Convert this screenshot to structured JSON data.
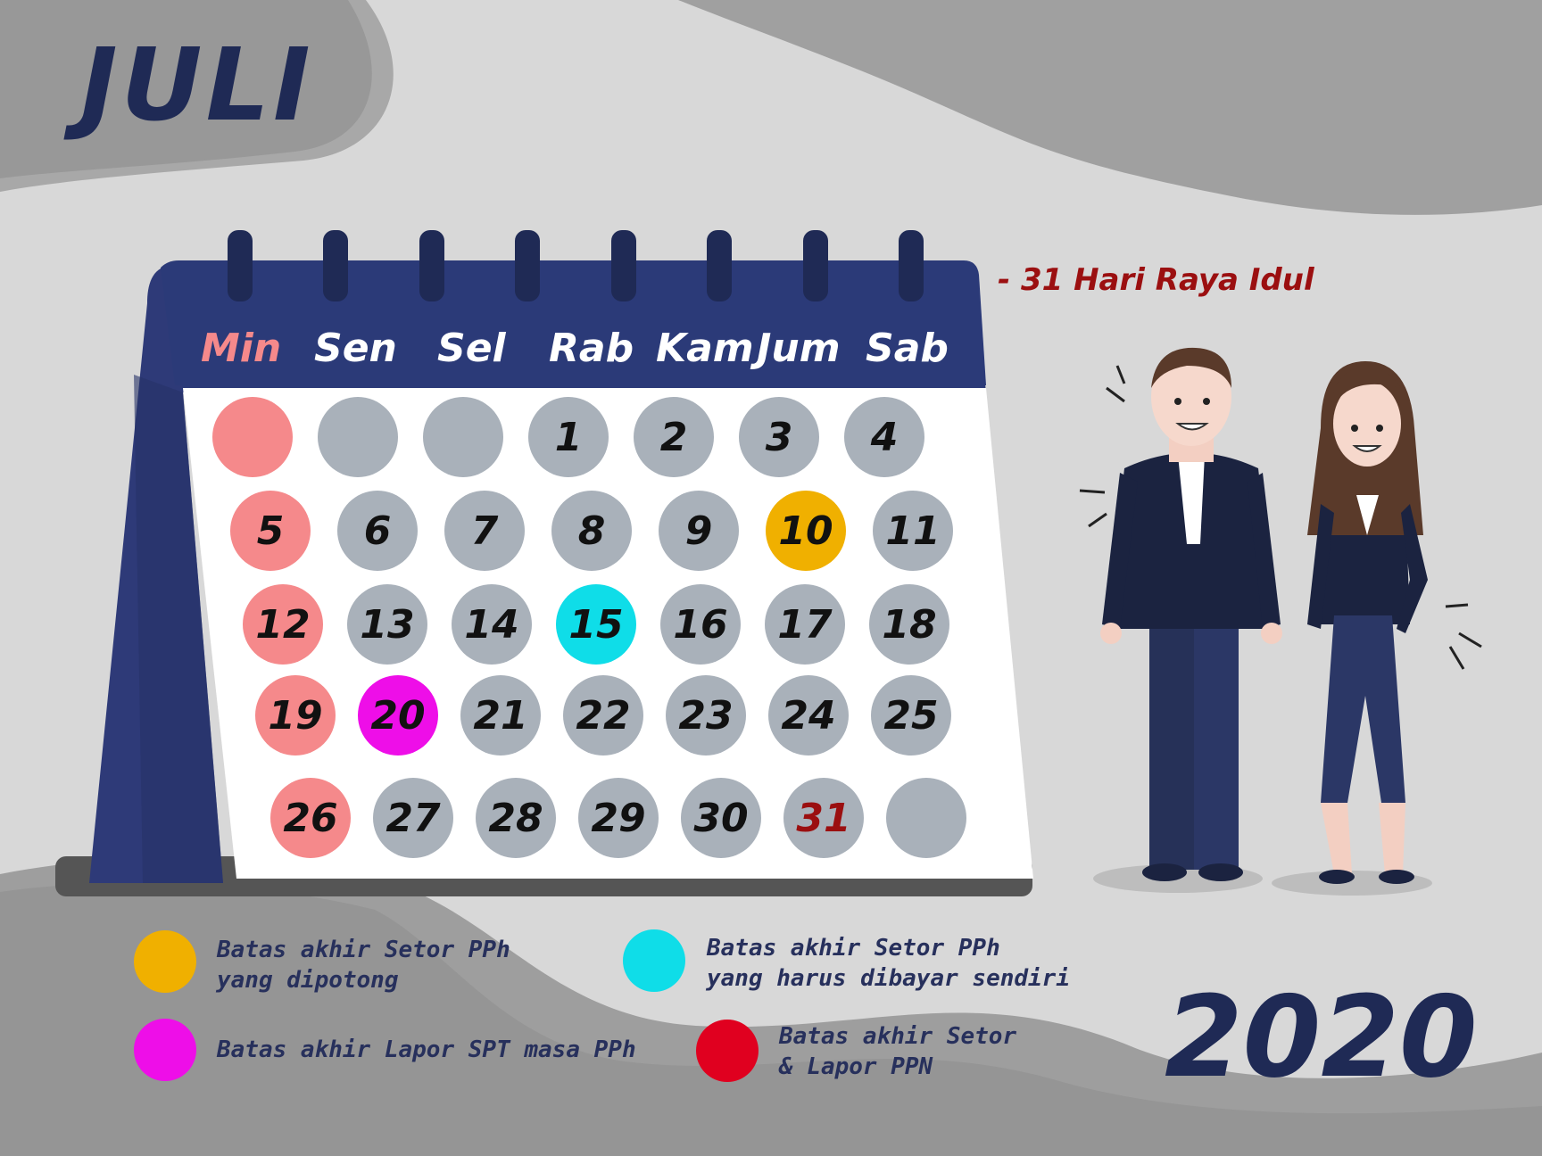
{
  "month": "JULI",
  "year": "2020",
  "holiday_note": "- 31 Hari Raya Idul",
  "day_names": [
    "Min",
    "Sen",
    "Sel",
    "Rab",
    "Kam",
    "Jum",
    "Sab"
  ],
  "weeks": [
    [
      "",
      "",
      "",
      "1",
      "2",
      "3",
      "4"
    ],
    [
      "5",
      "6",
      "7",
      "8",
      "9",
      "10",
      "11"
    ],
    [
      "12",
      "13",
      "14",
      "15",
      "16",
      "17",
      "18"
    ],
    [
      "19",
      "20",
      "21",
      "22",
      "23",
      "24",
      "25"
    ],
    [
      "26",
      "27",
      "28",
      "29",
      "30",
      "31",
      ""
    ]
  ],
  "colors": {
    "sunday": "#f5898b",
    "regular": "#a9b1ba",
    "orange": "#f0b000",
    "cyan": "#0fdde8",
    "magenta": "#ee0ee8",
    "red": "#e0001f",
    "navy": "#2e3a78",
    "holiday_text": "#9b0f10"
  },
  "highlights": {
    "10": "orange",
    "15": "cyan",
    "20": "magenta"
  },
  "holiday_text_dates": [
    "31"
  ],
  "legend": [
    {
      "color": "orange",
      "line1": "Batas akhir Setor PPh",
      "line2": "yang dipotong"
    },
    {
      "color": "cyan",
      "line1": "Batas akhir Setor PPh",
      "line2": "yang harus dibayar sendiri"
    },
    {
      "color": "magenta",
      "line1": "Batas akhir Lapor SPT masa PPh",
      "line2": ""
    },
    {
      "color": "red",
      "line1": "Batas akhir Setor",
      "line2": "& Lapor PPN"
    }
  ]
}
